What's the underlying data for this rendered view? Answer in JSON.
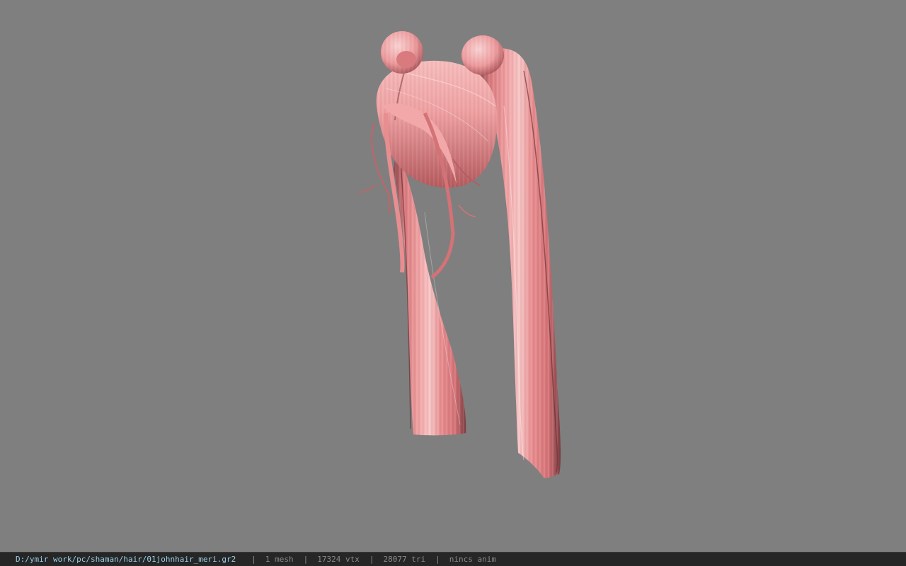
{
  "viewer": {
    "background_color": "#7f7f7f",
    "model": {
      "name": "pink-twin-tail-hair-model",
      "base_color": "#e58a8c",
      "highlight_color": "#f7c6c6",
      "shadow_color": "#7a3c40"
    }
  },
  "status_bar": {
    "file_path": "D:/ymir work/pc/shaman/hair/01johnhair_meri.gr2",
    "separator": "|",
    "mesh_count": "1 mesh",
    "vertex_count": "17324 vtx",
    "triangle_count": "28077 tri",
    "anim_status": "nincs anim"
  }
}
